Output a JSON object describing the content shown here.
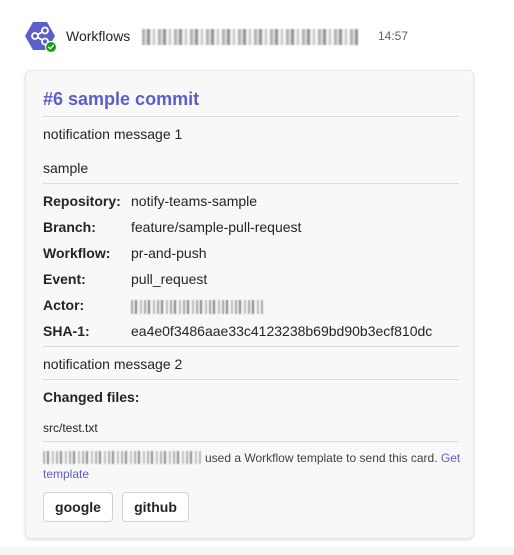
{
  "message": {
    "sender": "Workflows",
    "time": "14:57"
  },
  "card": {
    "title": "#6 sample commit",
    "text1": "notification message 1",
    "text2": "sample",
    "facts": [
      {
        "key": "Repository:",
        "value": "notify-teams-sample"
      },
      {
        "key": "Branch:",
        "value": "feature/sample-pull-request"
      },
      {
        "key": "Workflow:",
        "value": "pr-and-push"
      },
      {
        "key": "Event:",
        "value": "pull_request"
      },
      {
        "key": "Actor:",
        "value": ""
      },
      {
        "key": "SHA-1:",
        "value": "ea4e0f3486aae33c4123238b69bd90b3ecf810dc"
      }
    ],
    "text3": "notification message 2",
    "changed_files_title": "Changed files:",
    "changed_file": "src/test.txt",
    "footer_text": "used a Workflow template to send this card.",
    "footer_link": "Get template",
    "buttons": {
      "google": "google",
      "github": "github"
    }
  },
  "colors": {
    "accent": "#5b5fc7",
    "presence": "#13a10e"
  },
  "icons": {
    "avatar": "workflows-share-icon",
    "presence": "available-check-icon"
  }
}
